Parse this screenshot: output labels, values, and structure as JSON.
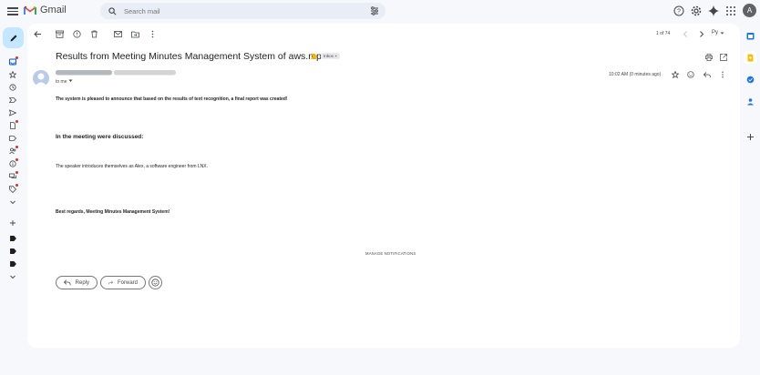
{
  "app": {
    "name": "Gmail",
    "avatar_letter": "A"
  },
  "search": {
    "placeholder": "Search mail"
  },
  "pager": {
    "text": "1 of 74"
  },
  "input_tool": {
    "label": "Ру"
  },
  "colors": {
    "accent": "#0b57d0",
    "compose_bg": "#c2e7ff",
    "important": "#f4b400",
    "unread_dot": "#d93025"
  },
  "email": {
    "subject": "Results from Meeting Minutes Management System of aws.mp3",
    "label_badge": "Inbox",
    "to_line": "to me",
    "timestamp": "10:02 AM (0 minutes ago)",
    "intro": "The system is pleased to announce that based on the results of text recognition, a final report was created!",
    "heading": "In the meeting were discussed:",
    "speaker_line": "The speaker introduces themselves as Alex, a software engineer from LNX.",
    "signoff": "Best regards, Meeting Minutes Management System!",
    "manage_link": "MANAGE NOTIFICATIONS",
    "reply_label": "Reply",
    "forward_label": "Forward"
  },
  "left_rail_icons": [
    "inbox-icon",
    "star-icon",
    "snooze-icon",
    "important-icon",
    "sent-icon",
    "drafts-icon",
    "label-icon",
    "contacts-icon",
    "info-icon",
    "forum-icon",
    "tag-icon",
    "more-icon"
  ],
  "label_icons": [
    "label-icon",
    "label-icon",
    "label-icon"
  ]
}
